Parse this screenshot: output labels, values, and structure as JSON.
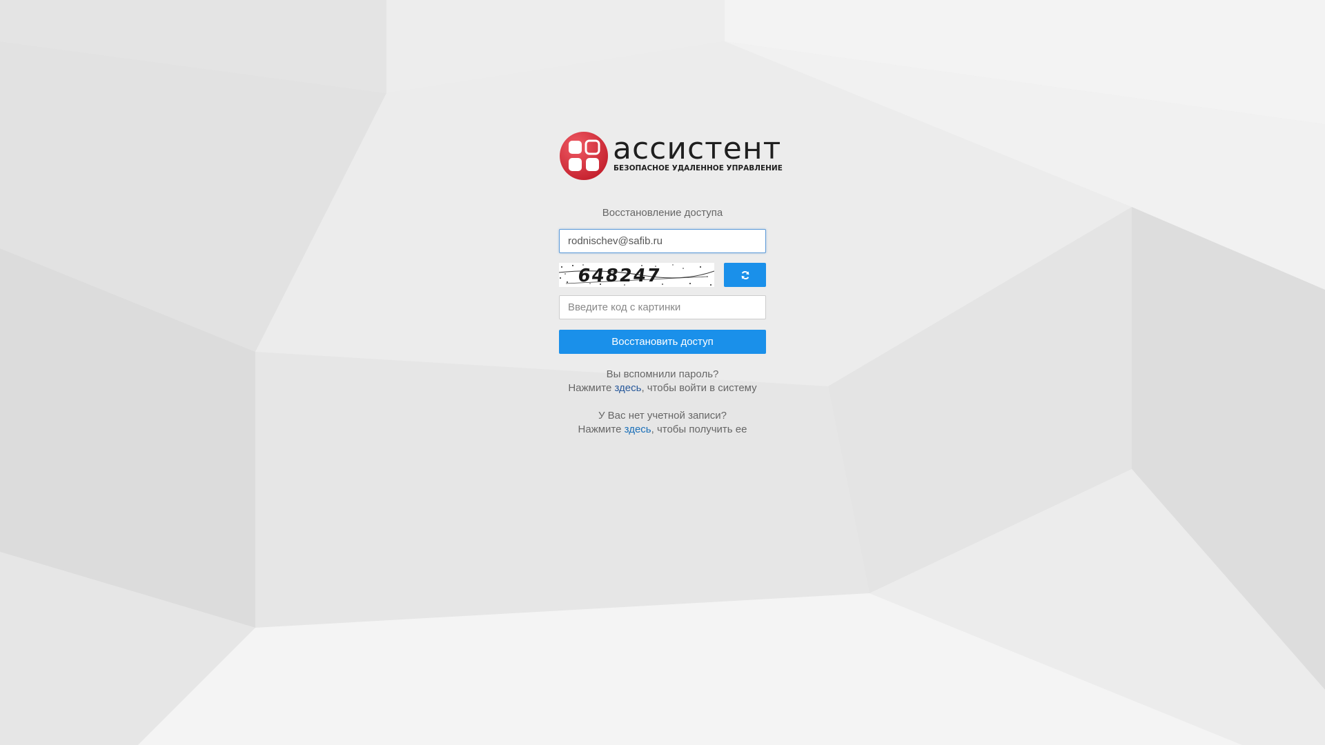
{
  "logo": {
    "name": "ассистент",
    "tagline": "БЕЗОПАСНОЕ УДАЛЕННОЕ УПРАВЛЕНИЕ"
  },
  "form": {
    "title": "Восстановление доступа",
    "email_value": "rodnischev@safib.ru",
    "captcha_text": "648247",
    "captcha_placeholder": "Введите код с картинки",
    "submit_label": "Восстановить доступ"
  },
  "login_hint": {
    "question": "Вы вспомнили пароль?",
    "prefix": "Нажмите ",
    "link": "здесь",
    "suffix": ", чтобы войти в систему"
  },
  "register_hint": {
    "question": "У Вас нет учетной записи?",
    "prefix": "Нажмите ",
    "link": "здесь",
    "suffix": ", чтобы получить ее"
  },
  "icons": {
    "refresh": "refresh-icon"
  },
  "colors": {
    "accent": "#1a90ea",
    "logo_red": "#d9333f",
    "link": "#1a6fb8",
    "text": "#666666"
  }
}
